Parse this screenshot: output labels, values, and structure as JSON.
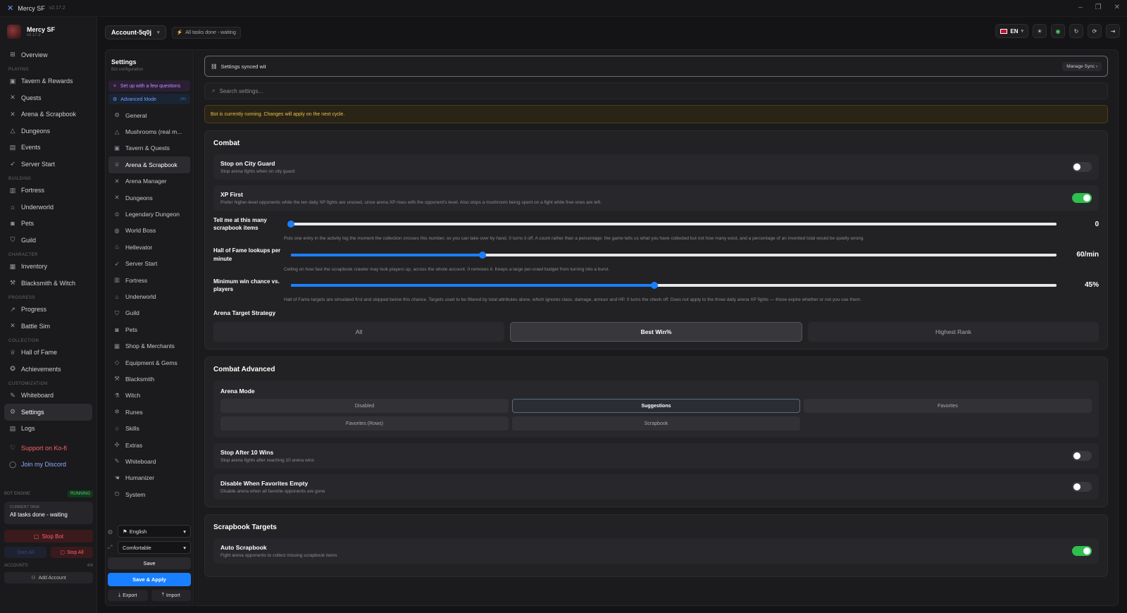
{
  "window": {
    "app_name": "Mercy SF",
    "version": "v2.17.2"
  },
  "brand": {
    "name": "Mercy SF",
    "version": "v2.17.2"
  },
  "sidebar": {
    "overview": "Overview",
    "sections": {
      "playing": "PLAYING",
      "building": "BUILDING",
      "character": "CHARACTER",
      "progress": "PROGRESS",
      "collection": "COLLECTION",
      "customization": "CUSTOMIZATION"
    },
    "items": {
      "tavern": "Tavern & Rewards",
      "quests": "Quests",
      "arena": "Arena & Scrapbook",
      "dungeons": "Dungeons",
      "events": "Events",
      "server_start": "Server Start",
      "fortress": "Fortress",
      "underworld": "Underworld",
      "pets": "Pets",
      "guild": "Guild",
      "inventory": "Inventory",
      "blacksmith": "Blacksmith & Witch",
      "progress": "Progress",
      "battle_sim": "Battle Sim",
      "hall_of_fame": "Hall of Fame",
      "achievements": "Achievements",
      "whiteboard": "Whiteboard",
      "settings": "Settings",
      "logs": "Logs"
    },
    "kofi": "Support on Ko-fi",
    "discord": "Join my Discord",
    "engine": {
      "label": "BOT ENGINE",
      "status": "RUNNING",
      "task_label": "CURRENT TASK",
      "task_value": "All tasks done - waiting",
      "stop_bot": "Stop Bot",
      "start_all": "Start All",
      "stop_all": "Stop All",
      "accounts_label": "ACCOUNTS",
      "accounts_count": "4/4",
      "add_account": "Add Account"
    }
  },
  "topbar": {
    "account": "Account-5q0j",
    "task": "All tasks done - waiting",
    "lang": "EN"
  },
  "settings_nav": {
    "title": "Settings",
    "subtitle": "Bot configuration",
    "setup": "Set up with a few questions",
    "advanced": "Advanced Mode",
    "advanced_state": "ON",
    "items": [
      "General",
      "Mushrooms (real m...",
      "Tavern & Quests",
      "Arena & Scrapbook",
      "Arena Manager",
      "Dungeons",
      "Legendary Dungeon",
      "World Boss",
      "Hellevator",
      "Server Start",
      "Fortress",
      "Underworld",
      "Guild",
      "Pets",
      "Shop & Merchants",
      "Equipment & Gems",
      "Blacksmith",
      "Witch",
      "Runes",
      "Skills",
      "Extras",
      "Whiteboard",
      "Humanizer",
      "System"
    ],
    "language": "English",
    "density": "Comfortable",
    "save": "Save",
    "save_apply": "Save & Apply",
    "export": "Export",
    "import": "Import"
  },
  "main": {
    "sync_text": "Settings synced wit",
    "manage_sync": "Manage Sync",
    "search_placeholder": "Search settings...",
    "warning": "Bot is currently running. Changes will apply on the next cycle.",
    "combat": {
      "title": "Combat",
      "stop_city_guard": {
        "title": "Stop on City Guard",
        "desc": "Stop arena fights when on city guard",
        "on": false
      },
      "xp_first": {
        "title": "XP First",
        "desc": "Prefer higher-level opponents while the ten daily XP fights are unused, since arena XP rises with the opponent's level. Also stops a mushroom being spent on a fight while free ones are left.",
        "on": true
      },
      "scrapbook_items": {
        "label": "Tell me at this many scrapbook items",
        "value": "0",
        "fraction": 0,
        "desc": "Puts one entry in the activity log the moment the collection crosses this number, so you can take over by hand. 0 turns it off. A count rather than a percentage: the game tells us what you have collected but not how many exist, and a percentage of an invented total would be quietly wrong."
      },
      "hof_lookups": {
        "label": "Hall of Fame lookups per minute",
        "value": "60/min",
        "fraction": 0.25,
        "desc": "Ceiling on how fast the scrapbook crawler may look players up, across the whole account. 0 removes it. Keeps a large per-crawl budget from turning into a burst."
      },
      "min_win": {
        "label": "Minimum win chance vs. players",
        "value": "45%",
        "fraction": 0.475,
        "desc": "Hall of Fame targets are simulated first and skipped below this chance. Targets used to be filtered by total attributes alone, which ignores class, damage, armour and HP. 0 turns the check off. Does not apply to the three daily arena XP fights — those expire whether or not you use them."
      },
      "strategy_label": "Arena Target Strategy",
      "strategy": [
        "All",
        "Best Win%",
        "Highest Rank"
      ],
      "strategy_selected": "Best Win%"
    },
    "combat_adv": {
      "title": "Combat Advanced",
      "mode_label": "Arena Mode",
      "modes": [
        "Disabled",
        "Suggestions",
        "Favorites",
        "Favorites (Rows)",
        "Scrapbook"
      ],
      "mode_selected": "Suggestions",
      "stop_after": {
        "title": "Stop After 10 Wins",
        "desc": "Stop arena fights after reaching 10 arena wins",
        "on": false
      },
      "disable_fav": {
        "title": "Disable When Favorites Empty",
        "desc": "Disable arena when all favorite opponents are gone",
        "on": false
      }
    },
    "scrapbook": {
      "title": "Scrapbook Targets",
      "auto": {
        "title": "Auto Scrapbook",
        "desc": "Fight arena opponents to collect missing scrapbook items",
        "on": true
      }
    }
  }
}
